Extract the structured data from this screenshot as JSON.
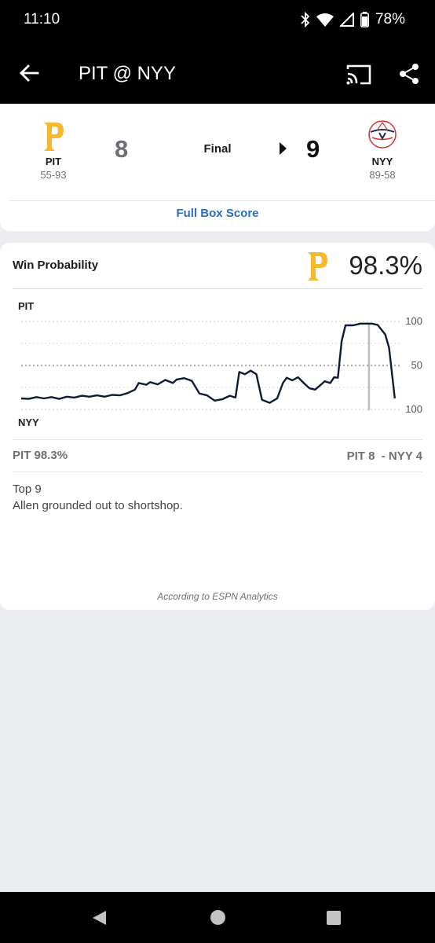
{
  "status_bar": {
    "time": "11:10",
    "battery": "78%"
  },
  "header": {
    "title": "PIT @ NYY"
  },
  "game": {
    "away": {
      "abbr": "PIT",
      "record": "55-93",
      "score": "8"
    },
    "home": {
      "abbr": "NYY",
      "record": "89-58",
      "score": "9"
    },
    "status": "Final",
    "box_score_link": "Full Box Score"
  },
  "win_probability": {
    "title": "Win Probability",
    "team_pct": "98.3%",
    "top_label": "PIT",
    "bottom_label": "NYY",
    "summary_left": "PIT 98.3%",
    "summary_right": "PIT 8  - NYY 4",
    "inning": "Top 9",
    "play": "Allen grounded out to shortshop.",
    "footnote": "According to ESPN Analytics"
  },
  "chart_data": {
    "type": "line",
    "y_tick_labels": [
      "100",
      "50",
      "100"
    ],
    "ylim": [
      -100,
      100
    ],
    "grid": true,
    "highlight_x": 0.917,
    "series": [
      {
        "values": [
          [
            0.0,
            -75
          ],
          [
            0.02,
            -76
          ],
          [
            0.04,
            -72
          ],
          [
            0.06,
            -75
          ],
          [
            0.08,
            -72
          ],
          [
            0.1,
            -76
          ],
          [
            0.12,
            -71
          ],
          [
            0.14,
            -73
          ],
          [
            0.16,
            -69
          ],
          [
            0.18,
            -71
          ],
          [
            0.2,
            -68
          ],
          [
            0.22,
            -71
          ],
          [
            0.24,
            -67
          ],
          [
            0.26,
            -68
          ],
          [
            0.28,
            -63
          ],
          [
            0.3,
            -55
          ],
          [
            0.31,
            -40
          ],
          [
            0.33,
            -44
          ],
          [
            0.34,
            -38
          ],
          [
            0.36,
            -43
          ],
          [
            0.38,
            -33
          ],
          [
            0.4,
            -40
          ],
          [
            0.41,
            -32
          ],
          [
            0.43,
            -29
          ],
          [
            0.45,
            -35
          ],
          [
            0.47,
            -64
          ],
          [
            0.49,
            -68
          ],
          [
            0.51,
            -80
          ],
          [
            0.53,
            -77
          ],
          [
            0.55,
            -69
          ],
          [
            0.565,
            -73
          ],
          [
            0.575,
            -15
          ],
          [
            0.59,
            -20
          ],
          [
            0.605,
            -12
          ],
          [
            0.62,
            -20
          ],
          [
            0.635,
            -78
          ],
          [
            0.655,
            -85
          ],
          [
            0.675,
            -75
          ],
          [
            0.69,
            -40
          ],
          [
            0.7,
            -28
          ],
          [
            0.715,
            -34
          ],
          [
            0.73,
            -27
          ],
          [
            0.745,
            -40
          ],
          [
            0.76,
            -52
          ],
          [
            0.775,
            -55
          ],
          [
            0.79,
            -44
          ],
          [
            0.8,
            -36
          ],
          [
            0.815,
            -40
          ],
          [
            0.825,
            -27
          ],
          [
            0.835,
            -28
          ],
          [
            0.845,
            55
          ],
          [
            0.855,
            91
          ],
          [
            0.875,
            91
          ],
          [
            0.895,
            95
          ],
          [
            0.925,
            95
          ],
          [
            0.94,
            92
          ],
          [
            0.96,
            70
          ],
          [
            0.97,
            40
          ],
          [
            0.985,
            -75
          ]
        ]
      }
    ]
  }
}
